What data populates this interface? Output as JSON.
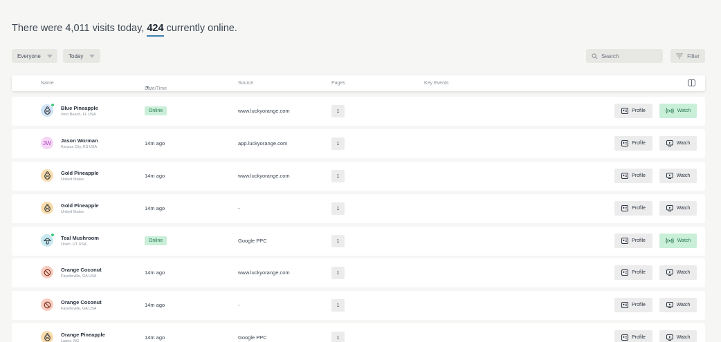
{
  "summary": {
    "prefix": "There were 4,011 visits today, ",
    "online_count": "424",
    "suffix": " currently online."
  },
  "filters": {
    "segment": "Everyone",
    "range": "Today"
  },
  "search": {
    "placeholder": "Search"
  },
  "filter_label": "Filter",
  "columns": {
    "name": "Name",
    "datetime": "Date/Time",
    "source": "Source",
    "pages": "Pages",
    "key_events": "Key Events"
  },
  "buttons": {
    "profile": "Profile",
    "watch": "Watch"
  },
  "rows": [
    {
      "name": "Blue Pineapple",
      "location": "Vero Beach, FL USA",
      "time": "Online",
      "source": "www.luckyorange.com",
      "pages": "1",
      "avatar": "pineapple-icon",
      "color": "#cfe3f6",
      "online": true
    },
    {
      "name": "Jason Worman",
      "location": "Kansas City, KS USA",
      "time": "14m ago",
      "source": "app.luckyorange.com",
      "pages": "1",
      "avatar": "JW",
      "color": "#f6d4f6",
      "online": false
    },
    {
      "name": "Gold Pineapple",
      "location": "United States",
      "time": "14m ago",
      "source": "www.luckyorange.com",
      "pages": "1",
      "avatar": "pineapple-icon",
      "color": "#f7dcae",
      "online": false
    },
    {
      "name": "Gold Pineapple",
      "location": "United States",
      "time": "14m ago",
      "source": "-",
      "pages": "1",
      "avatar": "pineapple-icon",
      "color": "#f7dcae",
      "online": false
    },
    {
      "name": "Teal Mushroom",
      "location": "Orem, UT USA",
      "time": "Online",
      "source": "Google PPC",
      "pages": "1",
      "avatar": "mushroom-icon",
      "color": "#c7e8ee",
      "online": true
    },
    {
      "name": "Orange Coconut",
      "location": "Fayetteville, GA USA",
      "time": "14m ago",
      "source": "www.luckyorange.com",
      "pages": "1",
      "avatar": "coconut-icon",
      "color": "#f8cdbf",
      "online": false
    },
    {
      "name": "Orange Coconut",
      "location": "Fayetteville, GA USA",
      "time": "14m ago",
      "source": "-",
      "pages": "1",
      "avatar": "coconut-icon",
      "color": "#f8cdbf",
      "online": false
    },
    {
      "name": "Orange Pineapple",
      "location": "Lagos, NG",
      "time": "14m ago",
      "source": "Google PPC",
      "pages": "1",
      "avatar": "pineapple-icon",
      "color": "#f7dcae",
      "online": false
    }
  ]
}
